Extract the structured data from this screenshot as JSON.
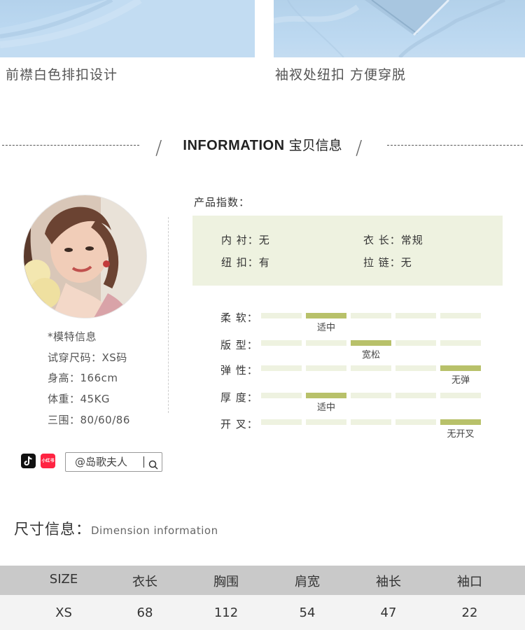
{
  "photos": {
    "left_caption": "前襟白色排扣设计",
    "right_caption": "袖衩处纽扣  方便穿脱"
  },
  "info_header": {
    "title_en": "INFORMATION",
    "title_cn": "宝贝信息"
  },
  "model": {
    "heading": "*模特信息",
    "size": "试穿尺码：XS码",
    "height": "身高：166cm",
    "weight": "体重：45KG",
    "measurements": "三围：80/60/86"
  },
  "social": {
    "tiktok_icon": "tiktok-icon",
    "xiaohongshu_label": "小红书",
    "handle": "@岛歌夫人",
    "search_icon": "search-icon"
  },
  "product_index": {
    "label": "产品指数：",
    "items": [
      {
        "label": "内 衬：无"
      },
      {
        "label": "衣 长：常规"
      },
      {
        "label": "纽 扣：有"
      },
      {
        "label": "拉 链：无"
      }
    ]
  },
  "scales": [
    {
      "label": "柔 软：",
      "level": 2,
      "value": "适中"
    },
    {
      "label": "版 型：",
      "level": 3,
      "value": "宽松"
    },
    {
      "label": "弹 性：",
      "level": 5,
      "value": "无弹"
    },
    {
      "label": "厚 度：",
      "level": 2,
      "value": "适中"
    },
    {
      "label": "开 叉：",
      "level": 5,
      "value": "无开叉"
    }
  ],
  "scale_colors": {
    "on": "#b8c16a",
    "off": "#eef2e0"
  },
  "dimension": {
    "title": "尺寸信息：",
    "subtitle": "Dimension information"
  },
  "size_table": {
    "headers": [
      "SIZE",
      "衣长",
      "胸围",
      "肩宽",
      "袖长",
      "袖口"
    ],
    "rows": [
      [
        "XS",
        "68",
        "112",
        "54",
        "47",
        "22"
      ]
    ]
  }
}
